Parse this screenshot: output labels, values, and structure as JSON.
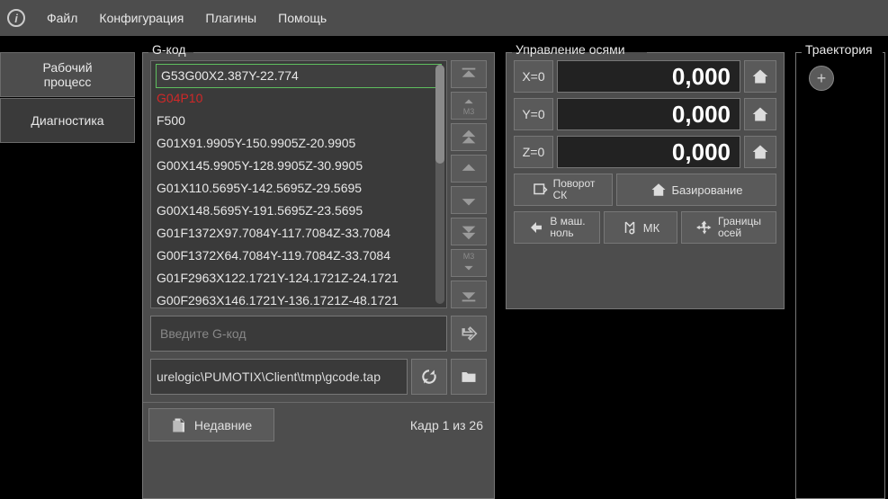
{
  "menu": {
    "items": [
      "Файл",
      "Конфигурация",
      "Плагины",
      "Помощь"
    ]
  },
  "left_tabs": {
    "workflow": "Рабочий\nпроцесс",
    "diagnostics": "Диагностика"
  },
  "gcode": {
    "title": "G-код",
    "lines": [
      "G53G00X2.387Y-22.774",
      "G04P10",
      "F500",
      "G01X91.9905Y-150.9905Z-20.9905",
      "G00X145.9905Y-128.9905Z-30.9905",
      "G01X110.5695Y-142.5695Z-29.5695",
      "G00X148.5695Y-191.5695Z-23.5695",
      "G01F1372X97.7084Y-117.7084Z-33.7084",
      "G00F1372X64.7084Y-119.7084Z-33.7084",
      "G01F2963X122.1721Y-124.1721Z-24.1721",
      "G00F2963X146.1721Y-136.1721Z-48.1721"
    ],
    "input_placeholder": "Введите G-код",
    "file_path": "urelogic\\PUMOTIX\\Client\\tmp\\gcode.tap",
    "recent_label": "Недавние",
    "frame_info": "Кадр 1 из 26"
  },
  "axes": {
    "title": "Управление осями",
    "rows": [
      {
        "label": "X=0",
        "value": "0,000"
      },
      {
        "label": "Y=0",
        "value": "0,000"
      },
      {
        "label": "Z=0",
        "value": "0,000"
      }
    ],
    "buttons": {
      "rotate_sk": "Поворот\nСК",
      "homing": "Базирование",
      "to_mach_zero": "В маш.\nноль",
      "mk": "МК",
      "axis_limits": "Границы\nосей"
    }
  },
  "trajectory": {
    "title": "Траектория"
  }
}
